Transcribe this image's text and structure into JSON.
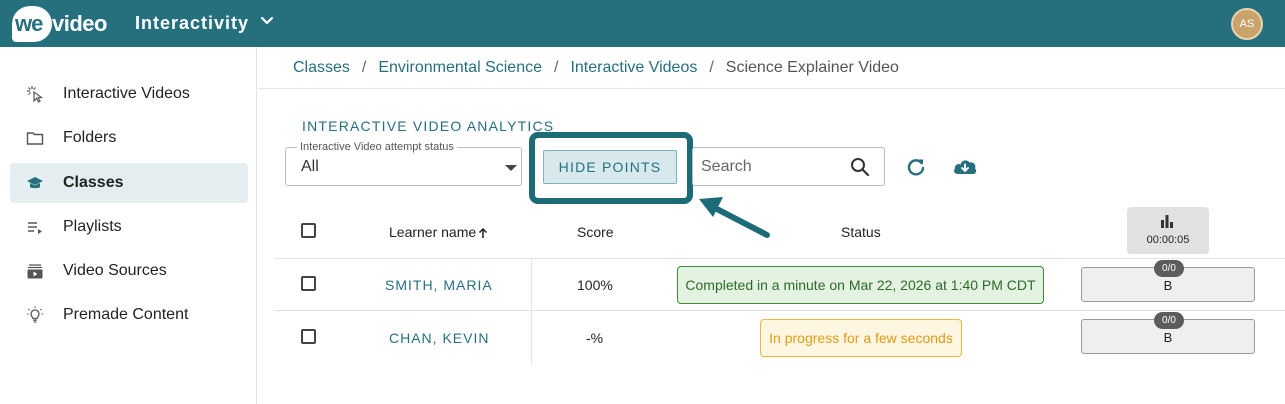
{
  "app": {
    "logo_we": "we",
    "logo_video": "video",
    "title": "Interactivity",
    "avatar_initials": "AS"
  },
  "sidebar": {
    "items": [
      {
        "label": "Interactive Videos",
        "icon": "cursor-click-icon"
      },
      {
        "label": "Folders",
        "icon": "folder-icon"
      },
      {
        "label": "Classes",
        "icon": "graduation-cap-icon",
        "active": true
      },
      {
        "label": "Playlists",
        "icon": "playlist-icon"
      },
      {
        "label": "Video Sources",
        "icon": "video-library-icon"
      },
      {
        "label": "Premade Content",
        "icon": "lightbulb-icon"
      }
    ]
  },
  "breadcrumb": {
    "items": [
      "Classes",
      "Environmental Science",
      "Interactive Videos"
    ],
    "separator": "/",
    "current": "Science Explainer Video"
  },
  "analytics": {
    "title": "INTERACTIVE VIDEO ANALYTICS",
    "status_filter_label": "Interactive Video attempt status",
    "status_filter_value": "All",
    "hide_points_label": "HIDE POINTS",
    "search_placeholder": "Search"
  },
  "table": {
    "headers": {
      "learner_name": "Learner name",
      "score": "Score",
      "status": "Status",
      "stats_time": "00:00:05"
    },
    "rows": [
      {
        "name": "SMITH, MARIA",
        "score": "100%",
        "status": "Completed in a minute on Mar 22, 2026 at 1:40 PM CDT",
        "status_type": "completed",
        "points": "0/0",
        "grade": "B"
      },
      {
        "name": "CHAN, KEVIN",
        "score": "-%",
        "status": "In progress for a few seconds",
        "status_type": "in-progress",
        "points": "0/0",
        "grade": "B"
      }
    ]
  },
  "colors": {
    "brand": "#26707e",
    "highlight": "#1e6b78",
    "completed_border": "#3f8b3a",
    "in_progress_border": "#f0b43c"
  }
}
